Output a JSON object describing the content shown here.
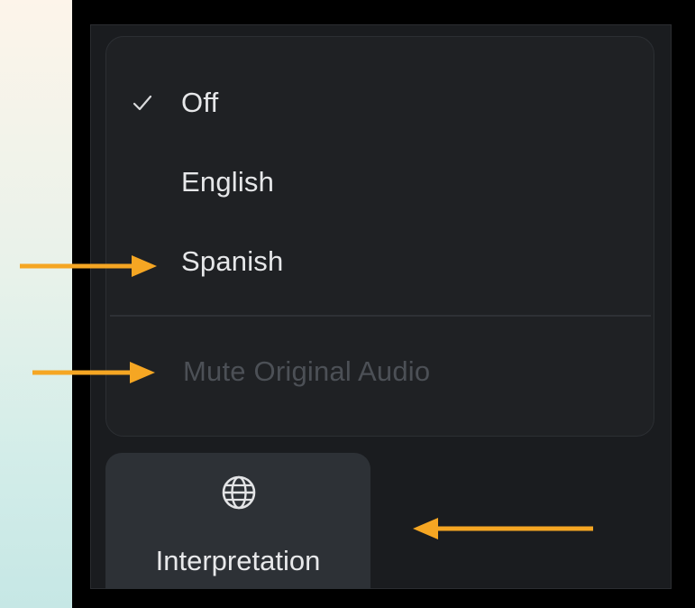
{
  "menu": {
    "items": [
      {
        "label": "Off",
        "checked": true,
        "enabled": true
      },
      {
        "label": "English",
        "checked": false,
        "enabled": true
      },
      {
        "label": "Spanish",
        "checked": false,
        "enabled": true
      }
    ],
    "mute_label": "Mute Original Audio",
    "mute_enabled": false
  },
  "interpretation_button": {
    "label": "Interpretation",
    "icon": "globe-icon"
  },
  "annotations": {
    "arrow_color": "#f5a623",
    "arrow_icon": "arrow-icon"
  },
  "colors": {
    "panel_bg": "#1a1c1f",
    "menu_bg": "#1f2124",
    "button_bg": "#2d3136",
    "text": "#e6e7e9",
    "disabled_text": "#4c5056"
  }
}
